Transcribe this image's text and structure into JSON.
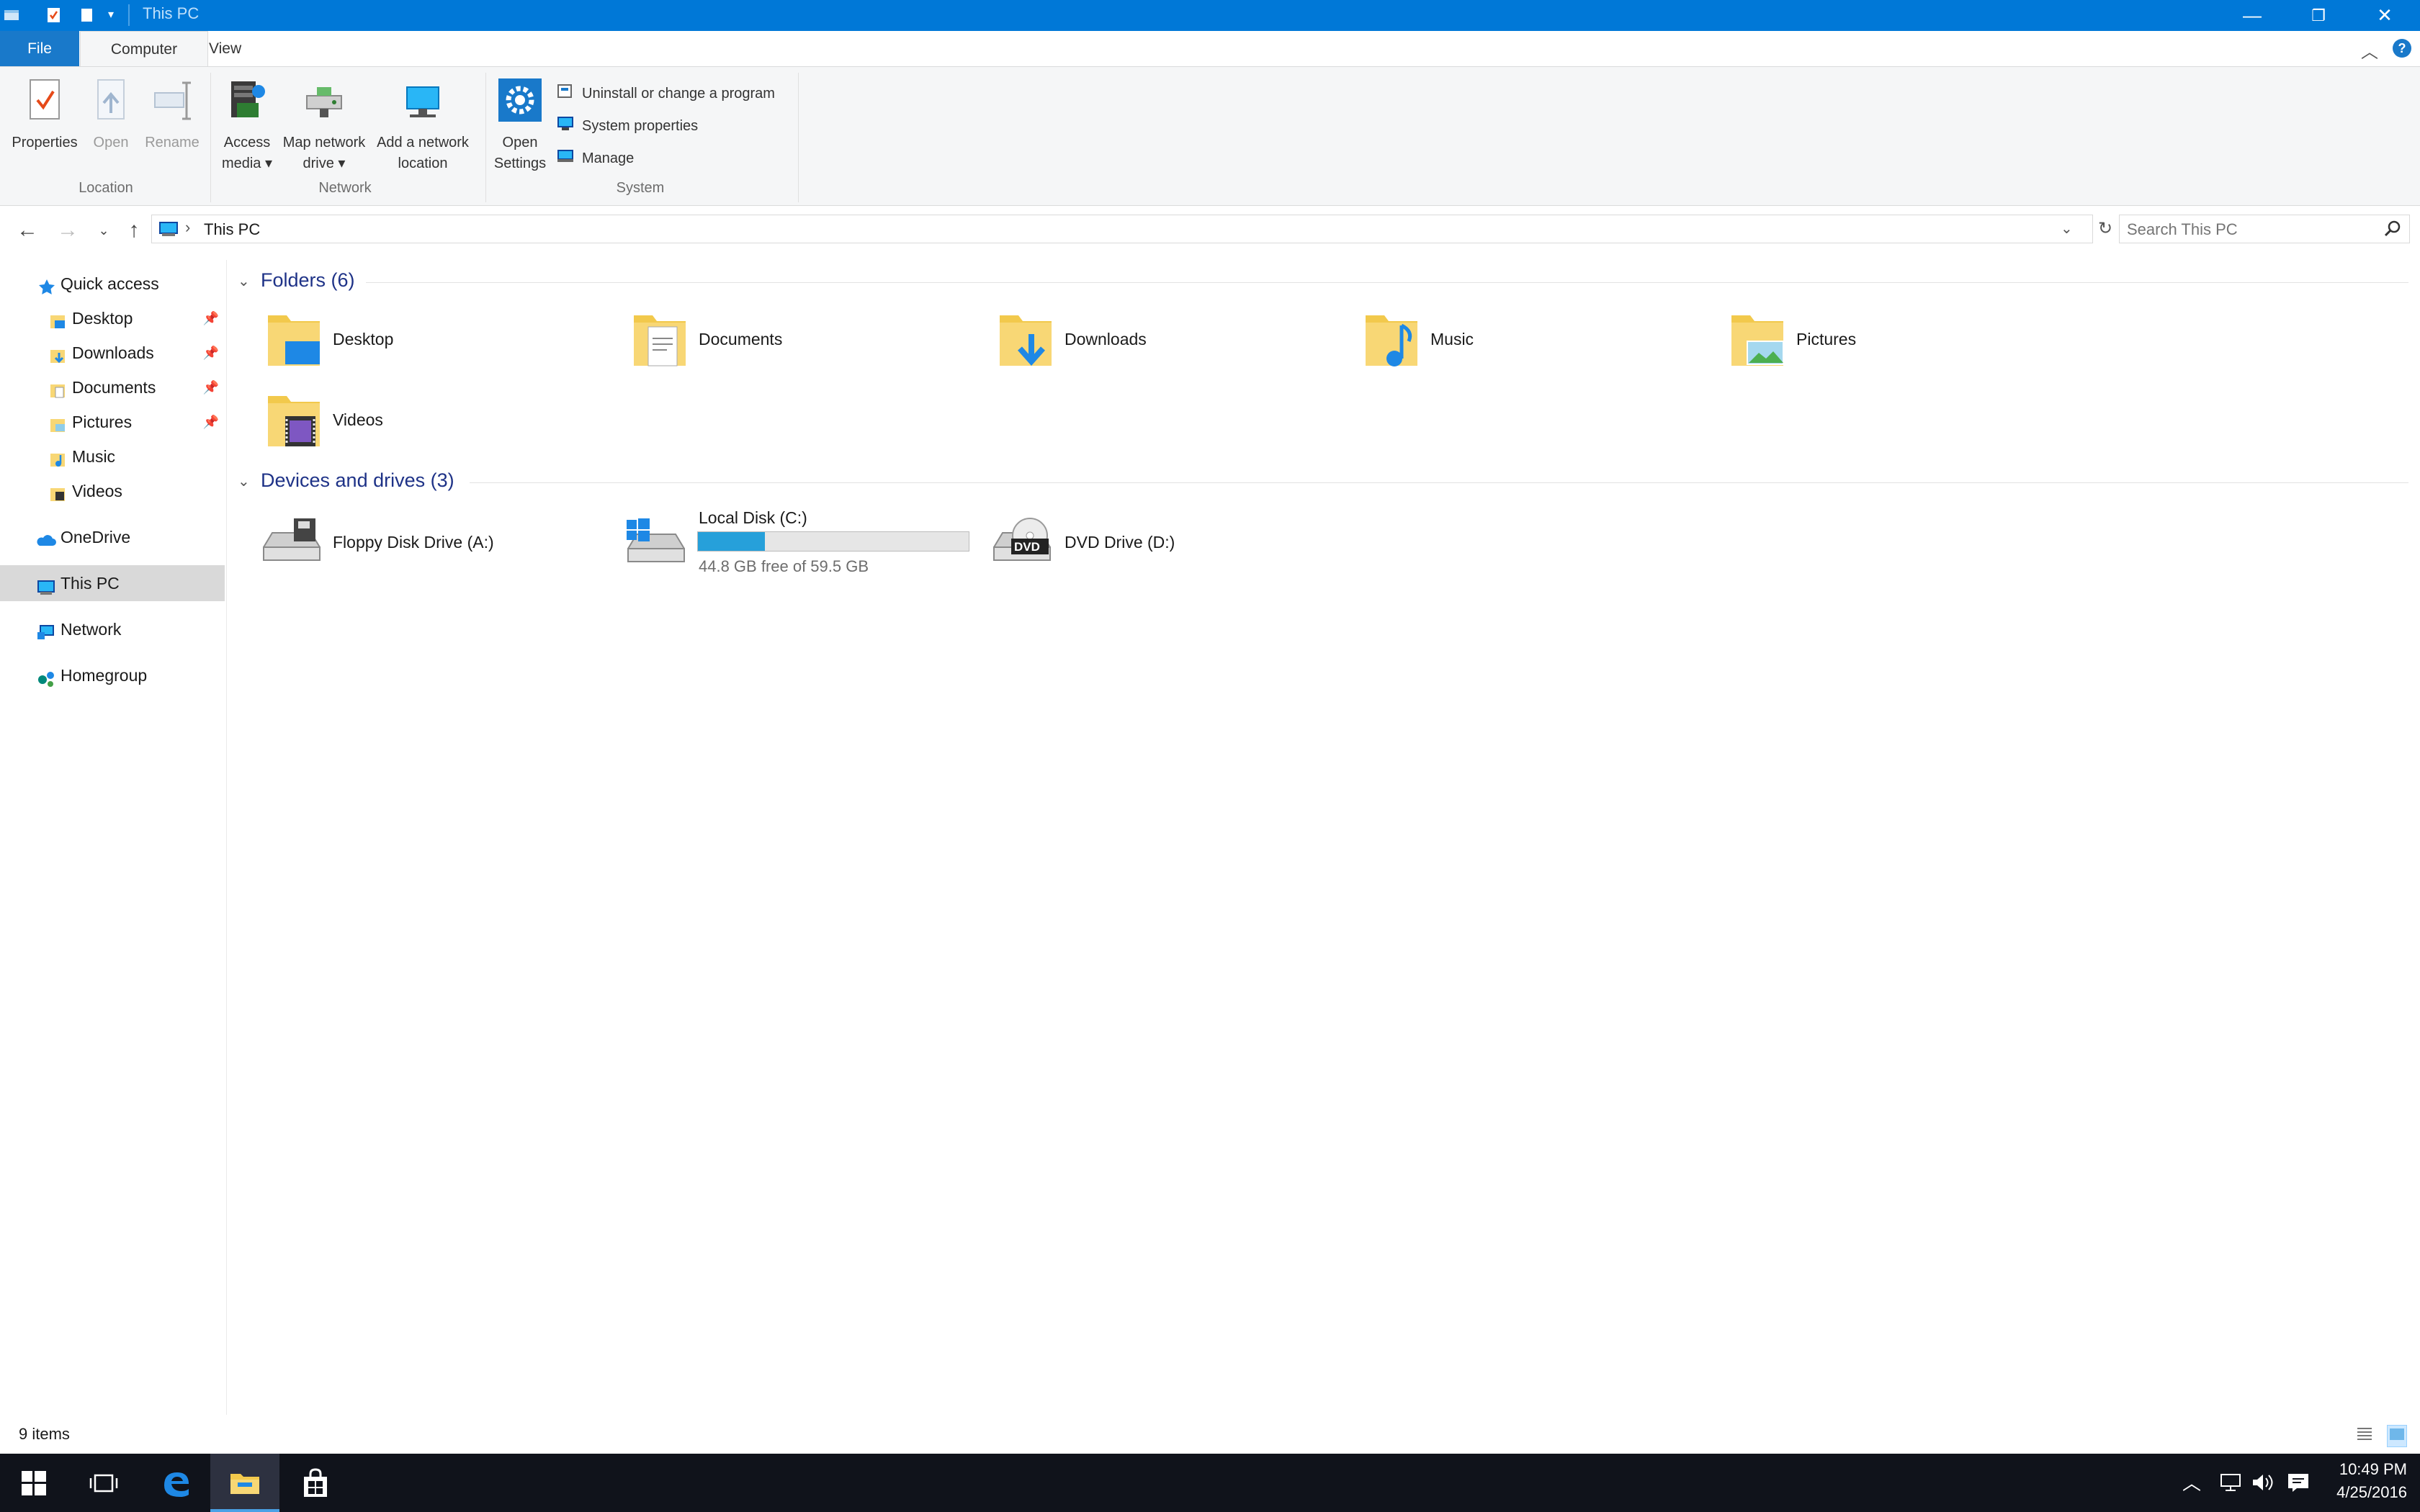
{
  "window": {
    "title": "This PC",
    "controls": {
      "minimize": "—",
      "restore": "❐",
      "close": "✕"
    }
  },
  "ribbon_tabs": [
    {
      "label": "File"
    },
    {
      "label": "Computer"
    },
    {
      "label": "View"
    }
  ],
  "ribbon": {
    "location": {
      "label": "Location",
      "buttons": [
        {
          "label": "Properties",
          "enabled": true,
          "icon": "checkmark-page-icon"
        },
        {
          "label": "Open",
          "enabled": false,
          "icon": "open-page-icon"
        },
        {
          "label": "Rename",
          "enabled": false,
          "icon": "rename-icon"
        }
      ]
    },
    "network": {
      "label": "Network",
      "buttons": [
        {
          "line1": "Access",
          "line2": "media",
          "icon": "media-server-icon"
        },
        {
          "line1": "Map network",
          "line2": "drive",
          "icon": "network-drive-icon"
        },
        {
          "line1": "Add a network",
          "line2": "location",
          "icon": "network-location-icon"
        }
      ]
    },
    "system": {
      "label": "System",
      "open_settings": {
        "line1": "Open",
        "line2": "Settings",
        "icon": "gear-icon"
      },
      "commands": [
        {
          "label": "Uninstall or change a program",
          "icon": "programs-icon"
        },
        {
          "label": "System properties",
          "icon": "computer-properties-icon"
        },
        {
          "label": "Manage",
          "icon": "computer-manage-icon"
        }
      ]
    }
  },
  "address": {
    "path_label": "This PC",
    "search_placeholder": "Search This PC"
  },
  "nav_pane": {
    "quick_access": "Quick access",
    "quick_items": [
      {
        "label": "Desktop",
        "pinned": true
      },
      {
        "label": "Downloads",
        "pinned": true
      },
      {
        "label": "Documents",
        "pinned": true
      },
      {
        "label": "Pictures",
        "pinned": true
      },
      {
        "label": "Music",
        "pinned": false
      },
      {
        "label": "Videos",
        "pinned": false
      }
    ],
    "onedrive": "OneDrive",
    "this_pc": "This PC",
    "network": "Network",
    "homegroup": "Homegroup"
  },
  "content": {
    "folders_title": "Folders (6)",
    "folders": [
      {
        "label": "Desktop",
        "icon": "desktop-folder-icon"
      },
      {
        "label": "Documents",
        "icon": "documents-folder-icon"
      },
      {
        "label": "Downloads",
        "icon": "downloads-folder-icon"
      },
      {
        "label": "Music",
        "icon": "music-folder-icon"
      },
      {
        "label": "Pictures",
        "icon": "pictures-folder-icon"
      },
      {
        "label": "Videos",
        "icon": "videos-folder-icon"
      }
    ],
    "drives_title": "Devices and drives (3)",
    "drives": [
      {
        "label": "Floppy Disk Drive (A:)",
        "icon": "floppy-drive-icon"
      },
      {
        "label": "Local Disk (C:)",
        "icon": "local-disk-icon",
        "free_text": "44.8 GB free of 59.5 GB",
        "used_fraction": 0.247
      },
      {
        "label": "DVD Drive (D:)",
        "icon": "dvd-drive-icon",
        "badge": "DVD"
      }
    ]
  },
  "status": {
    "items": "9 items"
  },
  "taskbar": {
    "time": "10:49 PM",
    "date": "4/25/2016"
  },
  "colors": {
    "titlebar": "#0078d7",
    "accent": "#1979ca",
    "section_title": "#1e3287",
    "progress": "#26a0da",
    "folder": "#f8d775",
    "taskbar": "#10131b"
  }
}
